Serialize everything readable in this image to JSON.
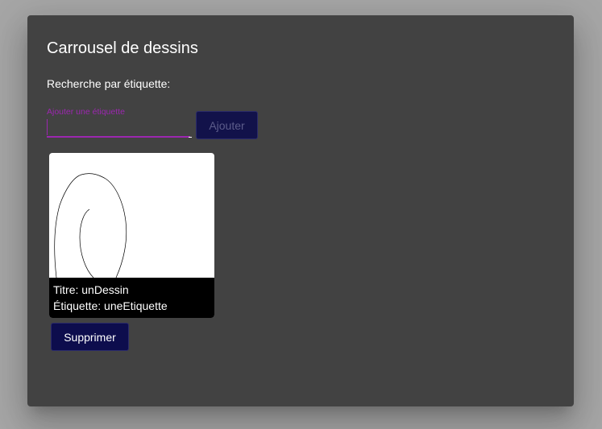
{
  "dialog": {
    "title": "Carrousel de dessins",
    "search_label": "Recherche par étiquette:",
    "tag_field": {
      "label": "Ajouter une étiquette",
      "value": ""
    },
    "add_button_label": "Ajouter",
    "drawings": [
      {
        "title_line": "Titre: unDessin",
        "tag_line": "Étiquette: uneEtiquette"
      }
    ],
    "delete_button_label": "Supprimer"
  },
  "colors": {
    "backdrop": "#a6a6a6",
    "dialog_bg": "#424242",
    "accent_purple": "#9c27b0",
    "button_bg": "#0d0d4d"
  }
}
